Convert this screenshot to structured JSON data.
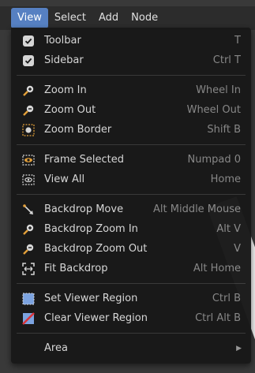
{
  "menubar": {
    "items": [
      "View",
      "Select",
      "Add",
      "Node"
    ]
  },
  "menu": {
    "groups": [
      [
        {
          "label": "Toolbar",
          "shortcut": "T",
          "icon": "checkbox-checked-icon"
        },
        {
          "label": "Sidebar",
          "shortcut": "Ctrl T",
          "icon": "checkbox-checked-icon"
        }
      ],
      [
        {
          "label": "Zoom In",
          "shortcut": "Wheel In",
          "icon": "zoom-in-icon"
        },
        {
          "label": "Zoom Out",
          "shortcut": "Wheel Out",
          "icon": "zoom-out-icon"
        },
        {
          "label": "Zoom Border",
          "shortcut": "Shift B",
          "icon": "zoom-border-icon"
        }
      ],
      [
        {
          "label": "Frame Selected",
          "shortcut": "Numpad 0",
          "icon": "frame-selected-icon"
        },
        {
          "label": "View All",
          "shortcut": "Home",
          "icon": "view-all-icon"
        }
      ],
      [
        {
          "label": "Backdrop Move",
          "shortcut": "Alt Middle Mouse",
          "icon": "backdrop-move-icon"
        },
        {
          "label": "Backdrop Zoom In",
          "shortcut": "Alt V",
          "icon": "zoom-in-icon"
        },
        {
          "label": "Backdrop Zoom Out",
          "shortcut": "V",
          "icon": "zoom-out-icon"
        },
        {
          "label": "Fit Backdrop",
          "shortcut": "Alt Home",
          "icon": "fit-backdrop-icon"
        }
      ],
      [
        {
          "label": "Set Viewer Region",
          "shortcut": "Ctrl B",
          "icon": "set-viewer-region-icon"
        },
        {
          "label": "Clear Viewer Region",
          "shortcut": "Ctrl Alt B",
          "icon": "clear-viewer-region-icon"
        }
      ],
      [
        {
          "label": "Area",
          "shortcut": "",
          "icon": "",
          "submenu": true
        }
      ]
    ]
  },
  "colors": {
    "menu_bg": "#181818",
    "active_tab": "#5680c2",
    "text": "#dcdcdc",
    "shortcut_text": "#8a8a8a"
  }
}
